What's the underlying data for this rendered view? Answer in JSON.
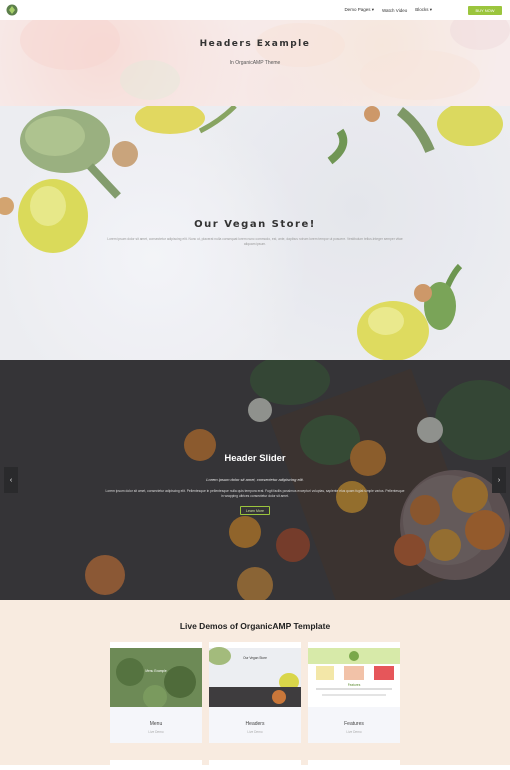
{
  "nav": {
    "links": [
      "Demo Pages ▾",
      "Watch Video",
      "Blocks ▾"
    ],
    "buy_label": "BUY NOW"
  },
  "hero1": {
    "title": "Headers Example",
    "subtitle": "In OrganicAMP Theme"
  },
  "hero2": {
    "title": "Our Vegan Store!",
    "text": "Lorem ipsum dolor sit amet, consectetur adipiscing elit. Nunc ut, placerat nulla consequat lorem nunc commodo, est, ante, dapibus rutrum lorem tempor ut posuere. Vestibulum tellus.Integer semper vitae aliquam ipsum."
  },
  "slider": {
    "title": "Header Slider",
    "subtitle": "Lorem ipsum dolor sit amet, consectetur adipiscing elit.",
    "text": "Lorem ipsum dolor sit amet, consectetur adipiscing elit. Pellentesque in pellentesque nulla quis tempora erat. Fugit facilis possimus excepturi voluptas, sapiente elus quam fugiat simple varius. Pellentesque in wrapping ultrices consectetur dolor sit amet.",
    "button_label": "Learn More",
    "prev_icon": "‹",
    "next_icon": "›"
  },
  "demos": {
    "title": "Live Demos of OrganicAMP Template",
    "cards": [
      {
        "title": "Menu",
        "subtitle": "Live Demo",
        "thumb_caption": "Menu Example"
      },
      {
        "title": "Headers",
        "subtitle": "Live Demo",
        "thumb_caption": "Our Vegan Store"
      },
      {
        "title": "Features",
        "subtitle": "Live Demo",
        "thumb_caption": "Features"
      }
    ]
  },
  "colors": {
    "accent": "#9bc53d",
    "peach_bg": "#f8ebe0",
    "slider_bg": "#3e3c3e"
  }
}
